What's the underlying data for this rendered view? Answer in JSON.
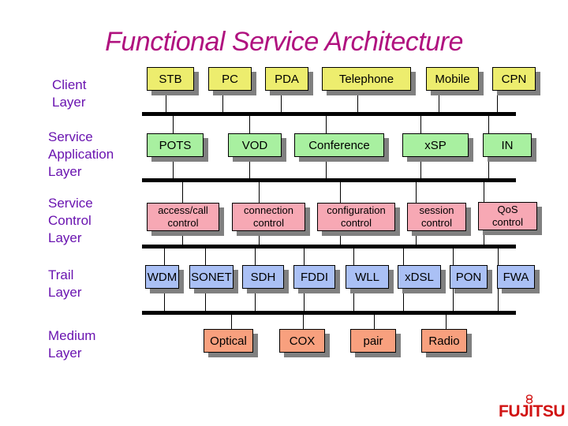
{
  "title": "Functional Service Architecture",
  "layers": [
    {
      "label_lines": [
        "Client",
        "Layer"
      ]
    },
    {
      "label_lines": [
        "Service",
        "Application",
        "Layer"
      ]
    },
    {
      "label_lines": [
        "Service",
        "Control",
        "Layer"
      ]
    },
    {
      "label_lines": [
        "Trail",
        "Layer"
      ]
    },
    {
      "label_lines": [
        "Medium",
        "Layer"
      ]
    }
  ],
  "client_nodes": [
    "STB",
    "PC",
    "PDA",
    "Telephone",
    "Mobile",
    "CPN"
  ],
  "application_nodes": [
    "POTS",
    "VOD",
    "Conference",
    "xSP",
    "IN"
  ],
  "control_nodes": [
    {
      "line1": "access/call",
      "line2": "control"
    },
    {
      "line1": "connection",
      "line2": "control"
    },
    {
      "line1": "configuration",
      "line2": "control"
    },
    {
      "line1": "session",
      "line2": "control"
    },
    {
      "line1": "QoS",
      "line2": "control"
    }
  ],
  "trail_nodes": [
    "WDM",
    "SONET",
    "SDH",
    "FDDI",
    "WLL",
    "xDSL",
    "PON",
    "FWA"
  ],
  "medium_nodes": [
    "Optical",
    "COX",
    "pair",
    "Radio"
  ],
  "logo": {
    "text": "FUJITSU",
    "icon": "infinity-mark-icon"
  },
  "colors": {
    "title": "#b0127f",
    "layer_label": "#6a14b0",
    "client": "#eded6e",
    "application": "#a8f0a0",
    "control": "#f7a8b4",
    "trail": "#aac0f5",
    "medium": "#f8a07e",
    "logo": "#d11313"
  }
}
